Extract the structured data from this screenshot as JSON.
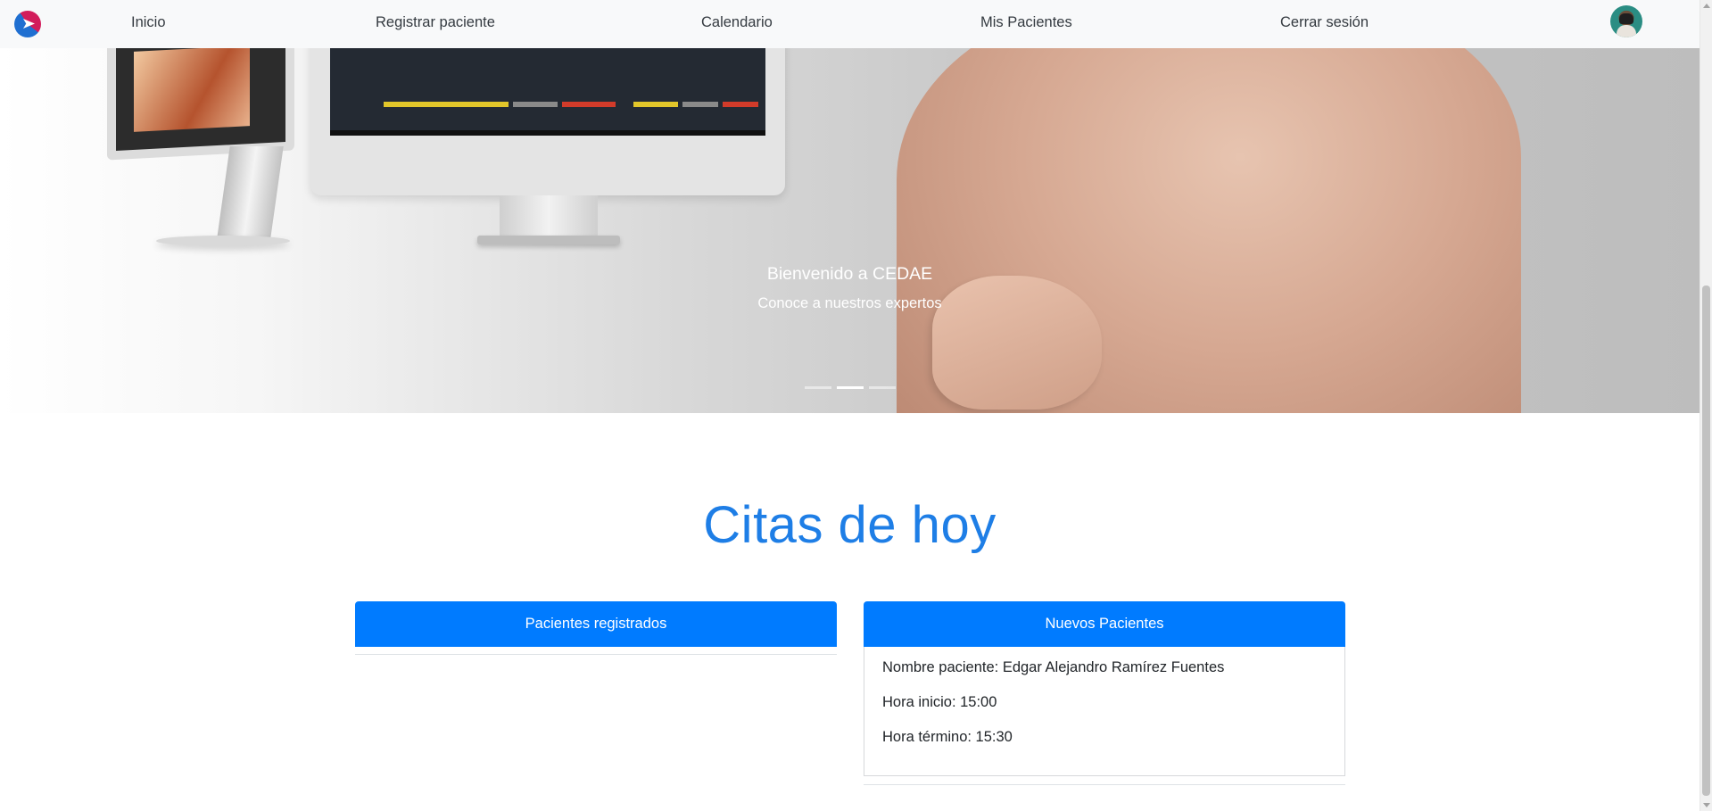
{
  "nav": {
    "logo_icon": "cedae-logo-icon",
    "items": [
      {
        "label": "Inicio"
      },
      {
        "label": "Registrar paciente"
      },
      {
        "label": "Calendario"
      },
      {
        "label": "Mis Pacientes"
      },
      {
        "label": "Cerrar sesión"
      }
    ],
    "avatar_icon": "user-avatar"
  },
  "hero": {
    "title": "Bienvenido a CEDAE",
    "subtitle": "Conoce a nuestros expertos",
    "slides": 3,
    "active_slide": 2
  },
  "main": {
    "title": "Citas de hoy",
    "registered": {
      "header": "Pacientes registrados"
    },
    "new_patients": {
      "header": "Nuevos Pacientes",
      "name_line": "Nombre paciente: Edgar Alejandro Ramírez Fuentes",
      "start_line": "Hora inicio: 15:00",
      "end_line": "Hora término: 15:30"
    }
  },
  "colors": {
    "accent": "#007bff",
    "title": "#1e7ee6",
    "navbar_bg": "#f8f9fa"
  }
}
